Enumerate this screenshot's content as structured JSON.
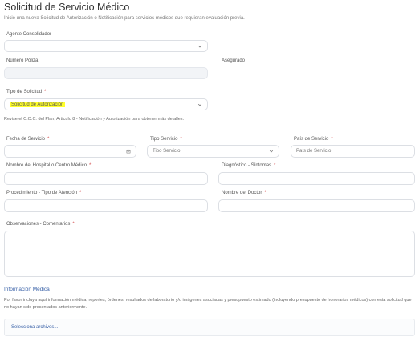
{
  "page": {
    "title": "Solicitud de Servicio Médico",
    "subtitle": "Inicie una nueva Solicitud de Autorización o Notificación para servicios médicos que requieran evaluación previa."
  },
  "form": {
    "agente": {
      "label": "Agente Consolidador",
      "value": ""
    },
    "poliza": {
      "label": "Número Póliza",
      "value": ""
    },
    "asegurado": {
      "label": "Asegurado",
      "value": ""
    },
    "tipo_solicitud": {
      "label": "Tipo de Solicitud",
      "required": "*",
      "value": "Solicitud de Autorización"
    },
    "note": "Revise el C.O.C. del Plan, Artículo 8 - Notificación y Autorización para obtener más detalles.",
    "fecha": {
      "label": "Fecha de Servicio",
      "required": "*",
      "value": ""
    },
    "tipo_servicio": {
      "label": "Tipo Servicio",
      "required": "*",
      "placeholder": "Tipo Servicio"
    },
    "pais": {
      "label": "País de Servicio",
      "required": "*",
      "placeholder": "País de Servicio"
    },
    "hospital": {
      "label": "Nombre del Hospital o Centro Médico",
      "required": "*",
      "value": ""
    },
    "diagnostico": {
      "label": "Diagnóstico - Síntomas",
      "required": "*",
      "value": ""
    },
    "procedimiento": {
      "label": "Procedimiento - Tipo de Atención",
      "required": "*",
      "value": ""
    },
    "doctor": {
      "label": "Nombre del Doctor",
      "required": "*",
      "value": ""
    },
    "observaciones": {
      "label": "Observaciones - Comentarios",
      "required": "*",
      "value": ""
    }
  },
  "info": {
    "title": "Información Médica",
    "text": "Por favor incluya aquí información médica, reportes, órdenes, resultados de laboratorio y/o imágenes asociadas y presupuesto estimado (incluyendo presupuesto de honorarios médicos) con esta solicitud que no hayan sido presentados anteriormente.",
    "files_label": "Selecciona archivos..."
  },
  "icons": {
    "chevron": "chevron-down-icon",
    "calendar": "calendar-icon"
  },
  "colors": {
    "highlight": "#ffff2a",
    "link": "#3a62a8",
    "required": "#d24545"
  }
}
